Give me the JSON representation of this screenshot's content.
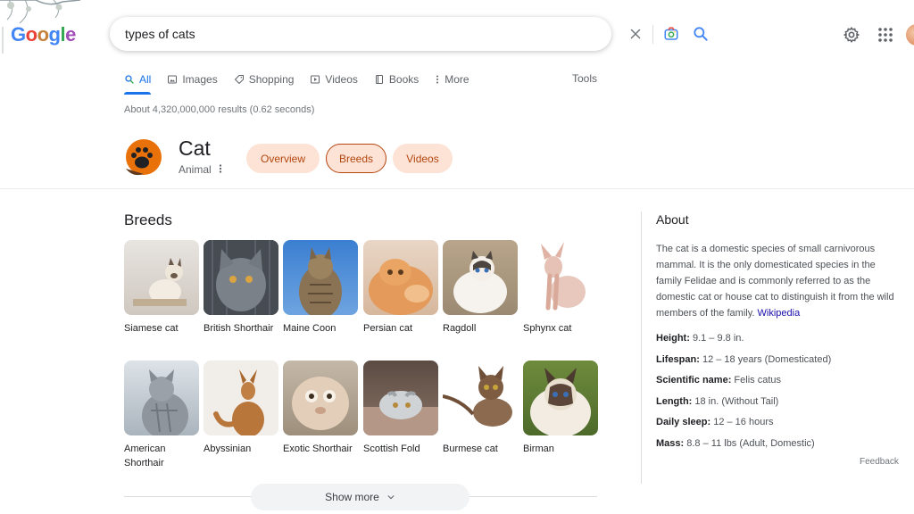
{
  "header": {
    "logo_letters": [
      "G",
      "o",
      "o",
      "g",
      "l",
      "e"
    ],
    "logo_colors": [
      "#4285f4",
      "#ea4335",
      "#fbbc05",
      "#4285f4",
      "#34a853",
      "#ea4335"
    ],
    "search_query": "types of cats",
    "icons": [
      "clear-icon",
      "lens-camera-icon",
      "search-icon",
      "gear-icon",
      "apps-grid-icon",
      "avatar"
    ]
  },
  "tabs": [
    {
      "label": "All",
      "icon": "search-icon",
      "active": true
    },
    {
      "label": "Images",
      "icon": "image-icon"
    },
    {
      "label": "Shopping",
      "icon": "tag-icon"
    },
    {
      "label": "Videos",
      "icon": "play-icon"
    },
    {
      "label": "Books",
      "icon": "book-icon"
    },
    {
      "label": "More",
      "icon": "kebab-icon"
    }
  ],
  "tools_label": "Tools",
  "result_stats": "About 4,320,000,000 results (0.62 seconds)",
  "entity": {
    "title": "Cat",
    "subtitle": "Animal",
    "chips": [
      "Overview",
      "Breeds",
      "Videos"
    ],
    "selected_chip": "Breeds"
  },
  "breeds": {
    "title": "Breeds",
    "items": [
      {
        "label": "Siamese cat"
      },
      {
        "label": "British Shorthair"
      },
      {
        "label": "Maine Coon"
      },
      {
        "label": "Persian cat"
      },
      {
        "label": "Ragdoll"
      },
      {
        "label": "Sphynx cat"
      },
      {
        "label": "American Shorthair"
      },
      {
        "label": "Abyssinian"
      },
      {
        "label": "Exotic Shorthair"
      },
      {
        "label": "Scottish Fold"
      },
      {
        "label": "Burmese cat"
      },
      {
        "label": "Birman"
      }
    ],
    "show_more": "Show more"
  },
  "about": {
    "title": "About",
    "description": "The cat is a domestic species of small carnivorous mammal. It is the only domesticated species in the family Felidae and is commonly referred to as the domestic cat or house cat to distinguish it from the wild members of the family.",
    "source_link": "Wikipedia",
    "facts": [
      {
        "key": "Height:",
        "value": "9.1 – 9.8 in."
      },
      {
        "key": "Lifespan:",
        "value": "12 – 18 years (Domesticated)"
      },
      {
        "key": "Scientific name:",
        "value": "Felis catus"
      },
      {
        "key": "Length:",
        "value": "18 in. (Without Tail)"
      },
      {
        "key": "Daily sleep:",
        "value": "12 – 16 hours"
      },
      {
        "key": "Mass:",
        "value": "8.8 – 11 lbs (Adult, Domestic)"
      }
    ],
    "feedback": "Feedback"
  },
  "colors": {
    "accent_blue": "#1a73e8",
    "chip_bg": "#fde3d5",
    "chip_text": "#b4460f",
    "link": "#1a0dab"
  }
}
